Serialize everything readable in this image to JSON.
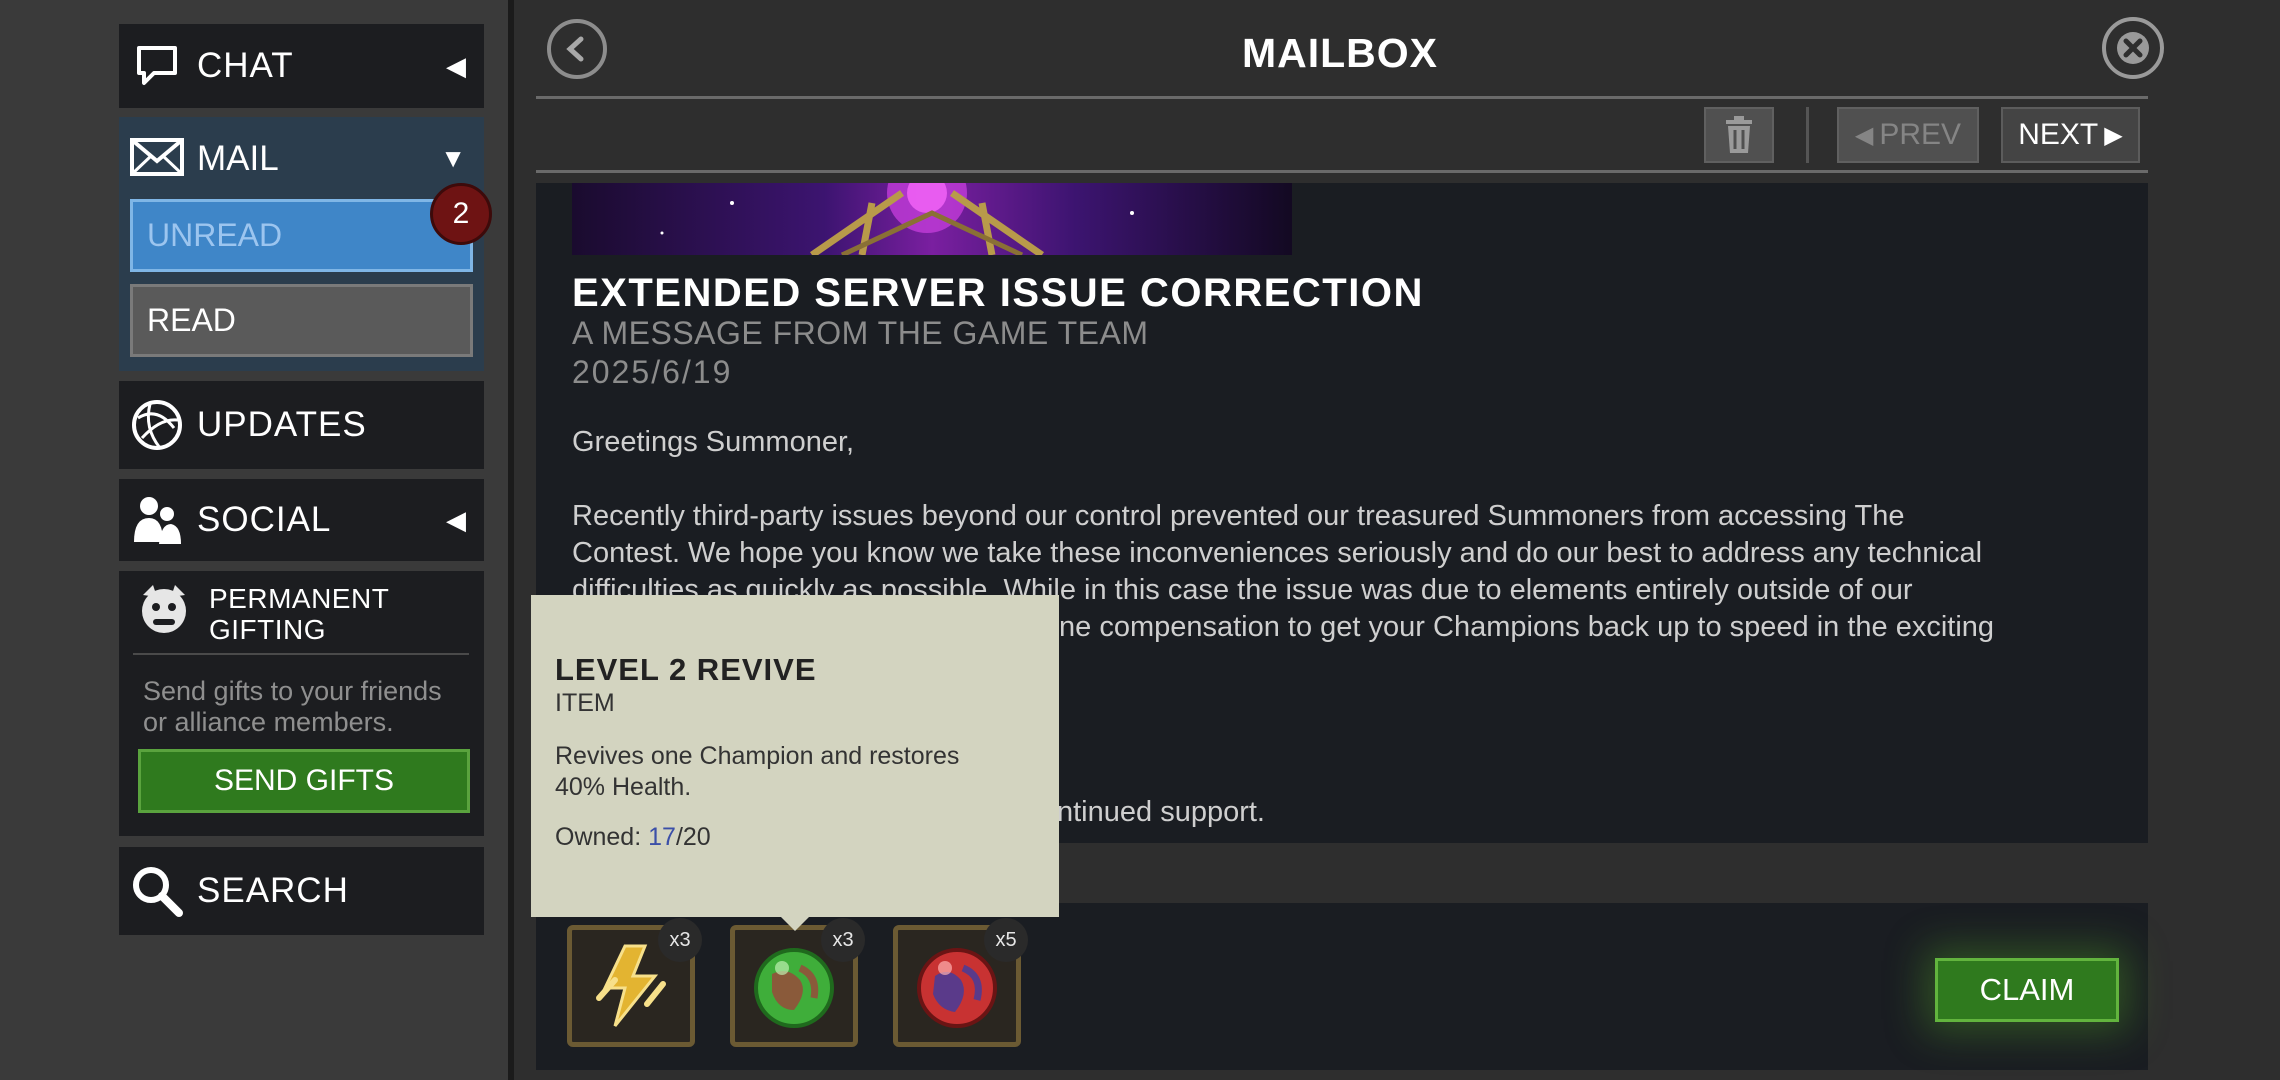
{
  "sidebar": {
    "chat": {
      "label": "CHAT",
      "icon": "chat-bubble-icon"
    },
    "mail": {
      "label": "MAIL",
      "icon": "envelope-icon",
      "unread_label": "UNREAD",
      "read_label": "READ",
      "badge": "2"
    },
    "updates": {
      "label": "UPDATES",
      "icon": "globe-icon"
    },
    "social": {
      "label": "SOCIAL",
      "icon": "people-icon"
    },
    "gifting": {
      "title_line1": "PERMANENT",
      "title_line2": "GIFTING",
      "icon": "gift-mascot-icon",
      "description": "Send gifts to your friends or alliance members.",
      "button": "SEND GIFTS"
    },
    "search": {
      "label": "SEARCH",
      "icon": "magnifier-icon"
    }
  },
  "header": {
    "title": "MAILBOX",
    "prev": "PREV",
    "next": "NEXT"
  },
  "message": {
    "title": "EXTENDED SERVER ISSUE CORRECTION",
    "subtitle": "A MESSAGE FROM THE GAME TEAM",
    "date": "2025/6/19",
    "greeting": "Greetings Summoner,",
    "para_line1": "Recently third-party issues beyond our control prevented our treasured Summoners from accessing The",
    "para_line2": "Contest. We hope you know we take these inconveniences seriously and do our best to address any technical",
    "para_line3": "difficulties as quickly as possible. While in this case the issue was due to elements entirely outside of our",
    "para_line4_visible": "ne compensation to get your Champions back up to speed in the exciting",
    "closing_visible": "ntinued support."
  },
  "tooltip": {
    "title": "LEVEL 2 REVIVE",
    "type": "ITEM",
    "description": "Revives one Champion and restores 40% Health.",
    "owned_label": "Owned:",
    "owned_current": "17",
    "owned_max": "/20"
  },
  "rewards": {
    "items": [
      {
        "name": "energy-item",
        "qty": "x3",
        "color": "#e3b431"
      },
      {
        "name": "level-2-revive-item",
        "qty": "x3",
        "color": "#3fae3a"
      },
      {
        "name": "health-potion-item",
        "qty": "x5",
        "color": "#c83232"
      }
    ],
    "claim": "CLAIM"
  },
  "colors": {
    "accent_blue": "#3f86c8",
    "green_button": "#2f7a1e",
    "badge_red": "#6e1313",
    "tooltip_bg": "#d3d4c0"
  }
}
